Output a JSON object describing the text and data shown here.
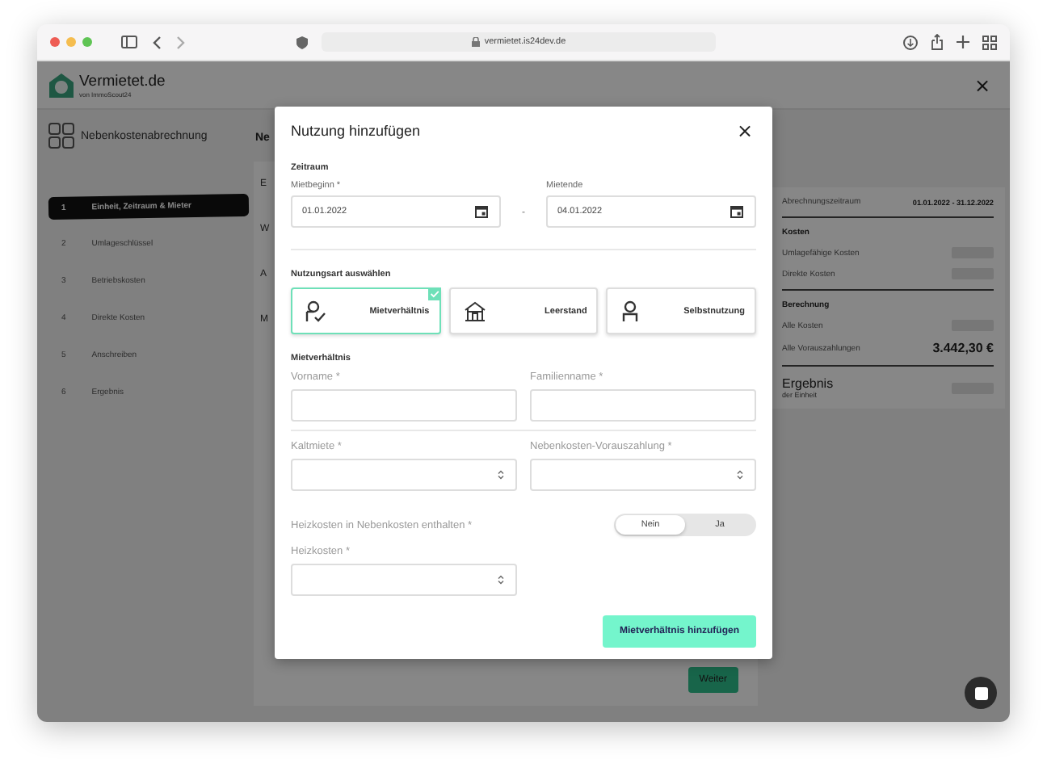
{
  "browser": {
    "url": "vermietet.is24dev.de"
  },
  "app": {
    "brand": "Vermietet.de",
    "brand_sub": "von ImmoScout24",
    "close": "×"
  },
  "sidebar": {
    "title": "Nebenkostenabrechnung",
    "steps": [
      {
        "number": "1",
        "label": "Einheit, Zeitraum & Mieter",
        "selected": true
      },
      {
        "number": "2",
        "label": "Umlageschlüssel",
        "selected": false
      },
      {
        "number": "3",
        "label": "Betriebskosten",
        "selected": false
      },
      {
        "number": "4",
        "label": "Direkte Kosten",
        "selected": false
      },
      {
        "number": "5",
        "label": "Anschreiben",
        "selected": false
      },
      {
        "number": "6",
        "label": "Ergebnis",
        "selected": false
      }
    ]
  },
  "main": {
    "title": "Ne",
    "fragments": [
      "E",
      "W",
      "A",
      "M"
    ],
    "next_button": "Weiter"
  },
  "summary": {
    "period_label": "Abrechnungszeitraum",
    "period": "01.01.2022 - 31.12.2022",
    "sections": [
      {
        "title": "Kosten",
        "rows": [
          {
            "label": "Umlagefähige Kosten",
            "loading": true
          },
          {
            "label": "Direkte Kosten",
            "loading": true
          }
        ]
      },
      {
        "title": "Berechnung",
        "rows": [
          {
            "label": "Alle Kosten",
            "loading": true
          },
          {
            "label": "Alle Vorauszahlungen",
            "loading": false,
            "value": "3.442,30 €"
          }
        ]
      }
    ],
    "result": {
      "title": "Ergebnis",
      "subtitle": "der Einheit",
      "loading": true
    }
  },
  "modal": {
    "title": "Nutzung hinzufügen",
    "close": "×",
    "period": {
      "heading": "Zeitraum",
      "start": {
        "label": "Mietbeginn *",
        "value": "01.01.2022"
      },
      "separator": "-",
      "end": {
        "label": "Mietende",
        "value": "04.01.2022"
      }
    },
    "usage": {
      "heading": "Nutzungsart auswählen",
      "options": [
        {
          "label": "Mietverhältnis",
          "selected": true
        },
        {
          "label": "Leerstand",
          "selected": false
        },
        {
          "label": "Selbstnutzung",
          "selected": false
        }
      ]
    },
    "tenancy": {
      "heading": "Mietverhältnis",
      "rows": [
        [
          {
            "label": "Vorname *",
            "kind": "text"
          },
          {
            "label": "Familienname *",
            "kind": "text"
          }
        ],
        [
          {
            "label": "Kaltmiete *",
            "kind": "number"
          },
          {
            "label": "Nebenkosten-Vorauszahlung *",
            "kind": "number"
          }
        ]
      ]
    },
    "heating_toggle": {
      "label": "Heizkosten in Nebenkosten enthalten *",
      "options": [
        {
          "label": "Nein",
          "selected": true
        },
        {
          "label": "Ja",
          "selected": false
        }
      ]
    },
    "heating": {
      "label": "Heizkosten *",
      "kind": "number"
    },
    "submit": "Mietverhältnis hinzufügen"
  }
}
